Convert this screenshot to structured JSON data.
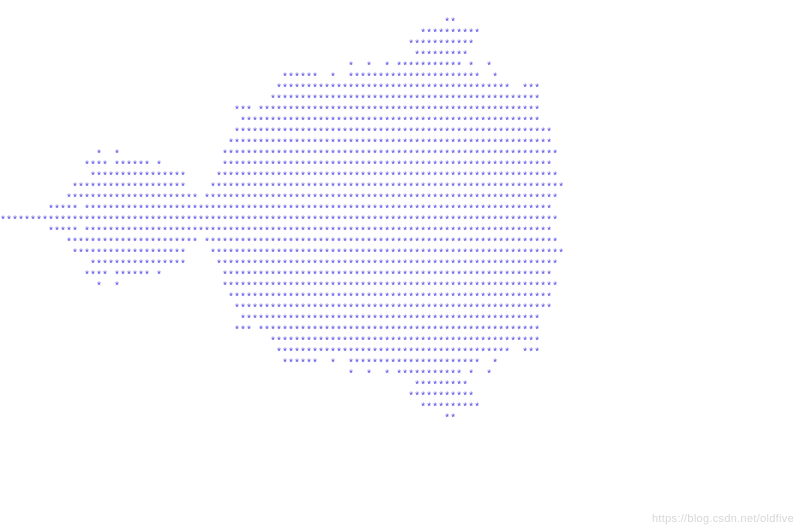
{
  "art": {
    "lines": [
      "                                                                          **",
      "                                                                      **********",
      "                                                                    ***********",
      "                                                                     *********",
      "                                                          *  *  * *********** *  *",
      "                                               ******  *  **********************  *",
      "                                              ***************************************  ***",
      "                                             *********************************************",
      "                                       *** ***********************************************",
      "                                        **************************************************",
      "                                       *****************************************************",
      "                                      ******************************************************",
      "                *  *                 ********************************************************",
      "              **** ****** *          *******************************************************",
      "               ****************     *********************************************************",
      "            *******************    ***********************************************************",
      "           ********************** ***********************************************************",
      "        ***** ******************************************************************************",
      "*********************************************************************************************",
      "        ***** ******************************************************************************",
      "           ********************** ***********************************************************",
      "            *******************    ***********************************************************",
      "               ****************     *********************************************************",
      "              **** ****** *          *******************************************************",
      "                *  *                 ********************************************************",
      "                                      ******************************************************",
      "                                       *****************************************************",
      "                                        **************************************************",
      "                                       *** ***********************************************",
      "                                             *********************************************",
      "                                              ***************************************  ***",
      "                                               ******  *  **********************  *",
      "                                                          *  *  * *********** *  *",
      "                                                                     *********",
      "                                                                    ***********",
      "                                                                      **********",
      "                                                                          **"
    ]
  },
  "watermark": "https://blog.csdn.net/oldfive"
}
